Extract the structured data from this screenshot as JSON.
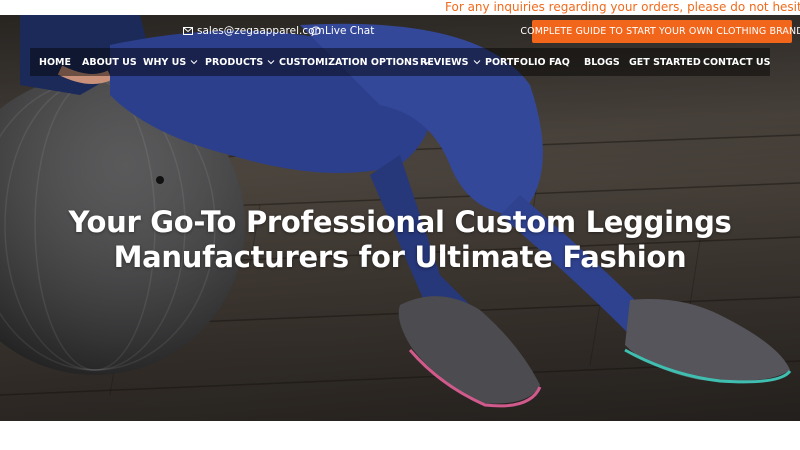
{
  "ticker": {
    "text": "For any inquiries regarding your orders, please do not hesitate to contact u"
  },
  "topbar": {
    "email": "sales@zegaapparel.com",
    "live_chat": "Live Chat",
    "cta_label": "COMPLETE GUIDE TO START YOUR OWN CLOTHING BRAND",
    "cta_color": "#f2661c"
  },
  "nav": {
    "items": [
      {
        "label": "HOME",
        "dropdown": false
      },
      {
        "label": "ABOUT US",
        "dropdown": false
      },
      {
        "label": "WHY US",
        "dropdown": true
      },
      {
        "label": "PRODUCTS",
        "dropdown": true
      },
      {
        "label": "CUSTOMIZATION OPTIONS",
        "dropdown": true
      },
      {
        "label": "REVIEWS",
        "dropdown": true
      },
      {
        "label": "PORTFOLIO",
        "dropdown": false
      },
      {
        "label": "FAQ",
        "dropdown": false
      },
      {
        "label": "BLOGS",
        "dropdown": false
      },
      {
        "label": "GET STARTED",
        "dropdown": false
      },
      {
        "label": "CONTACT US",
        "dropdown": false
      }
    ]
  },
  "hero": {
    "headline_line1": "Your Go-To Professional Custom Leggings",
    "headline_line2": "Manufacturers for Ultimate Fashion",
    "accent_color": "#f26a1b"
  }
}
